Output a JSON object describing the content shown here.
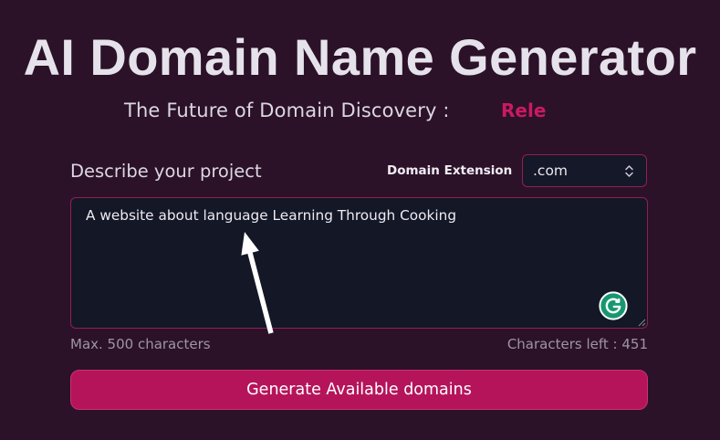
{
  "header": {
    "title": "AI Domain Name Generator",
    "tagline": "The Future of Domain Discovery :",
    "tagline_typing_word": "Rele"
  },
  "form": {
    "description_label": "Describe your project",
    "description_value": "A website about language Learning Through Cooking",
    "extension_label": "Domain Extension",
    "extension_selected": ".com",
    "max_chars_hint": "Max. 500 characters",
    "chars_left_label": "Characters left :",
    "chars_left_value": "451",
    "submit_label": "Generate Available domains"
  },
  "icons": {
    "extension_select": "chevron-up-down-icon",
    "description_field_assistant": "grammarly-icon",
    "description_field_resize": "resize-grip-icon",
    "annotation": "annotation-arrow"
  },
  "colors": {
    "background": "#2b1228",
    "title_text": "#e6e2eb",
    "body_text": "#dcd7e2",
    "accent": "#b5145b",
    "accent_border": "#c8326f",
    "highlight_text": "#c91a63",
    "field_background": "#131726",
    "field_border": "#951d55",
    "muted_text": "#9e95a3",
    "assistant_green": "#16976f",
    "annotation": "#ffffff"
  }
}
